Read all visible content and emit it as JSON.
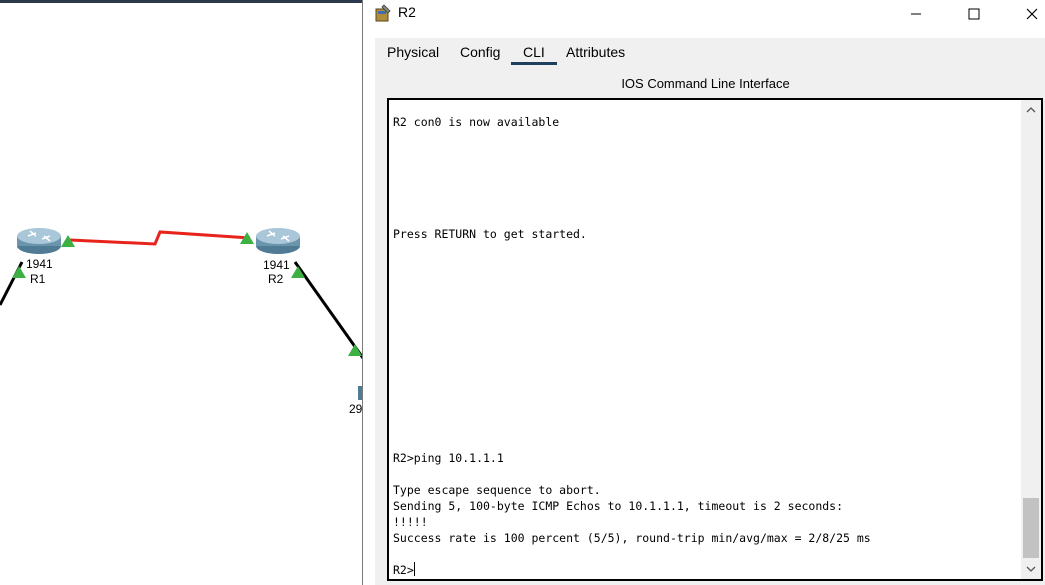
{
  "topology": {
    "devices": [
      {
        "id": "r1",
        "model": "1941",
        "name": "R1"
      },
      {
        "id": "r2",
        "model": "1941",
        "name": "R2"
      },
      {
        "id": "sw",
        "model_partial": "29"
      }
    ],
    "colors": {
      "serial_link": "#e8231c",
      "ethernet_link": "#000000",
      "link_up": "#3cb043"
    }
  },
  "window": {
    "title": "R2",
    "icon": "router-config-icon",
    "minimize_icon": "minimize-icon",
    "maximize_icon": "maximize-icon",
    "close_icon": "close-icon"
  },
  "tabs": [
    {
      "label": "Physical",
      "active": false
    },
    {
      "label": "Config",
      "active": false
    },
    {
      "label": "CLI",
      "active": true
    },
    {
      "label": "Attributes",
      "active": false
    }
  ],
  "cli": {
    "heading": "IOS Command Line Interface",
    "output": "R2 con0 is now available\n\n\n\n\n\n\nPress RETURN to get started.\n\n\n\n\n\n\n\n\n\n\n\n\n\nR2>ping 10.1.1.1\n\nType escape sequence to abort.\nSending 5, 100-byte ICMP Echos to 10.1.1.1, timeout is 2 seconds:\n!!!!!\nSuccess rate is 100 percent (5/5), round-trip min/avg/max = 2/8/25 ms",
    "prompt": "R2>",
    "scroll_position": 0.92
  }
}
